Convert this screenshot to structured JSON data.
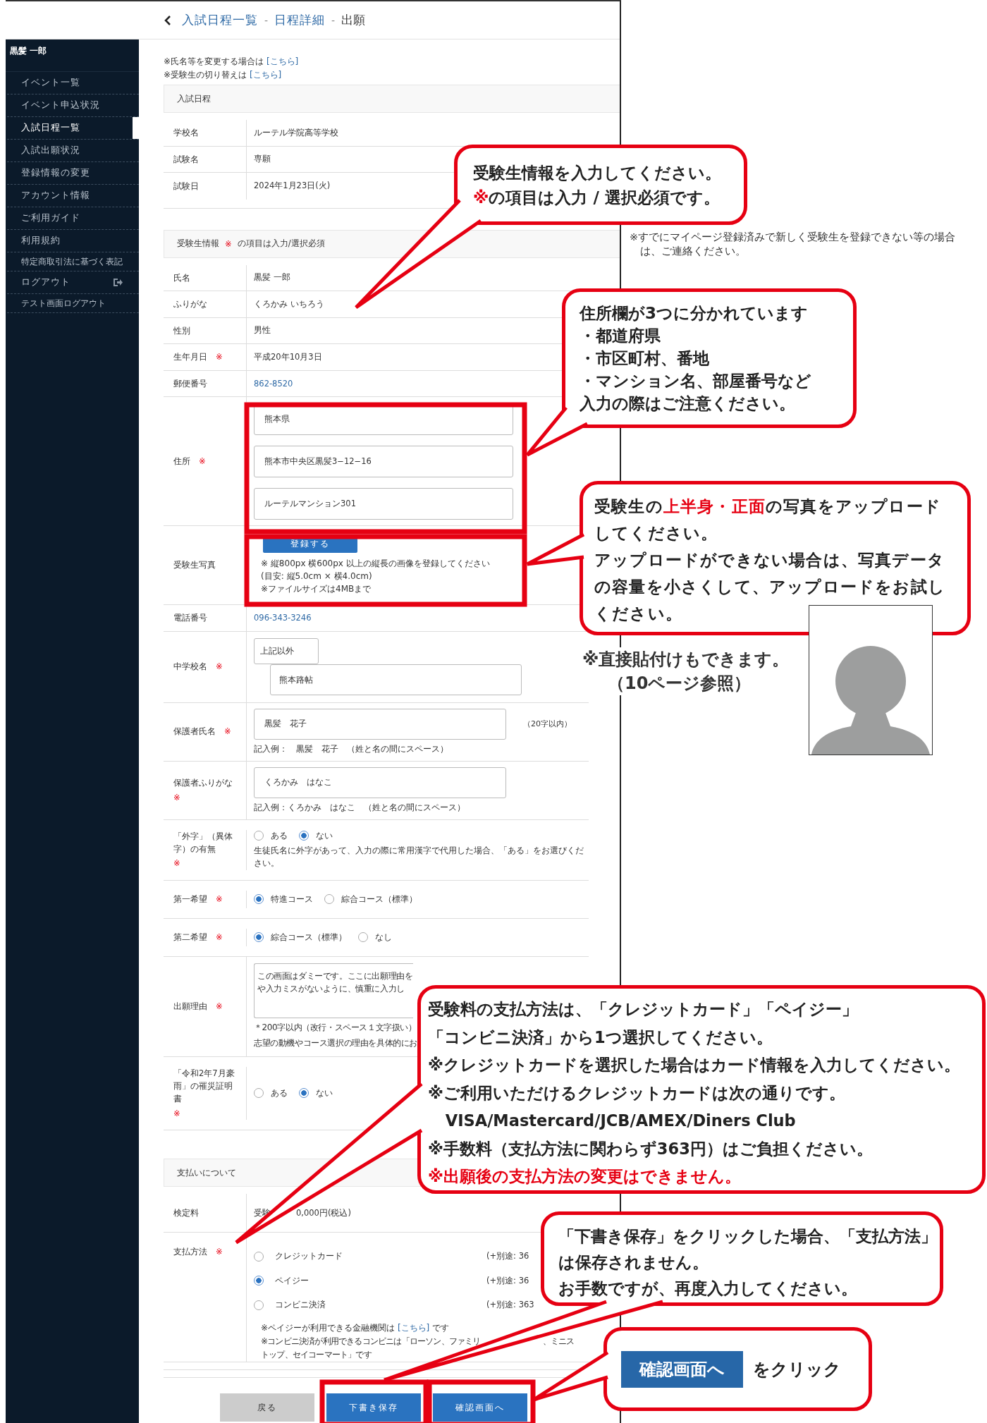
{
  "breadcrumb": [
    {
      "kind": "link",
      "label": "入試日程一覧"
    },
    {
      "kind": "separator",
      "label": "-"
    },
    {
      "kind": "link",
      "label": "日程詳細"
    },
    {
      "kind": "separator",
      "label": "-"
    },
    {
      "kind": "current",
      "label": "出願"
    }
  ],
  "sidebar": {
    "user": "黒髪 一郎",
    "items": [
      {
        "kind": "normal",
        "label": "イベント一覧",
        "selected": false
      },
      {
        "kind": "normal",
        "label": "イベント申込状況",
        "selected": false
      },
      {
        "kind": "normal",
        "label": "入試日程一覧",
        "selected": true
      },
      {
        "kind": "normal",
        "label": "入試出願状況",
        "selected": false
      },
      {
        "kind": "normal",
        "label": "登録情報の変更",
        "selected": false
      },
      {
        "kind": "normal",
        "label": "アカウント情報",
        "selected": false
      },
      {
        "kind": "normal",
        "label": "ご利用ガイド",
        "selected": false
      },
      {
        "kind": "normal",
        "label": "利用規約",
        "selected": false
      },
      {
        "kind": "small",
        "label": "特定商取引法に基づく表記",
        "selected": false
      },
      {
        "kind": "logout",
        "label": "ログアウト",
        "selected": false
      },
      {
        "kind": "small",
        "label": "テスト画面ログアウト",
        "selected": false
      }
    ]
  },
  "notes": [
    {
      "text": "※氏名等を変更する場合は",
      "link": "[こちら]"
    },
    {
      "text": "※受験生の切り替えは",
      "link": "[こちら]"
    }
  ],
  "schedule": {
    "title": "入試日程",
    "rows": [
      {
        "label": "学校名",
        "value": "ルーテル学院高等学校"
      },
      {
        "label": "試験名",
        "value": "専願"
      },
      {
        "label": "試験日",
        "value": "2024年1月23日(火)"
      }
    ]
  },
  "applicant": {
    "title": "受験生情報",
    "title_mark": "※",
    "title_note": "の項目は入力/選択必須",
    "rows": [
      {
        "kind": "text",
        "label": "氏名",
        "value": "黒髪 一郎"
      },
      {
        "kind": "text",
        "label": "ふりがな",
        "value": "くろかみ いちろう"
      },
      {
        "kind": "text",
        "label": "性別",
        "value": "男性"
      },
      {
        "kind": "text",
        "label": "生年月日",
        "mark": "※",
        "value": "平成20年10月3日"
      },
      {
        "kind": "link",
        "label": "郵便番号",
        "value": "862-8520"
      },
      {
        "kind": "address",
        "label": "住所",
        "mark": "※",
        "inputs": [
          "熊本県",
          "熊本市中央区黒髪3−12−16",
          "ルーテルマンション301"
        ]
      },
      {
        "kind": "upload",
        "label": "受験生写真",
        "button": "登録する",
        "notes": [
          "※ 縦800px 横600px 以上の縦長の画像を登録してください",
          "(目安: 縦5.0cm × 横4.0cm)",
          "※ファイルサイズは4MBまで"
        ]
      },
      {
        "kind": "link",
        "label": "電話番号",
        "value": "096-343-3246"
      },
      {
        "kind": "school",
        "label": "中学校名",
        "mark": "※",
        "select": "上記以外",
        "input": "熊本路帖"
      },
      {
        "kind": "input",
        "label": "保護者氏名",
        "mark": "※",
        "value": "黒髪　花子",
        "suffix": "（20字以内）",
        "hint": "記入例：　黒髪　花子　（姓と名の間にスペース）"
      },
      {
        "kind": "input",
        "label": "保護者ふりがな",
        "mark": "※",
        "value": "くろかみ　はなこ",
        "hint": "記入例：くろかみ　はなこ　（姓と名の間にスペース）"
      },
      {
        "kind": "radio",
        "label": "「外字」（異体字）の有無",
        "mark": "※",
        "options": [
          {
            "label": "ある",
            "selected": false
          },
          {
            "label": "ない",
            "selected": true
          }
        ],
        "note": "生徒氏名に外字があって、入力の際に常用漢字で代用した場合、「ある」をお選びください。"
      },
      {
        "kind": "radio",
        "label": "第一希望",
        "mark": "※",
        "options": [
          {
            "label": "特進コース",
            "selected": true
          },
          {
            "label": "綜合コース（標準）",
            "selected": false
          }
        ]
      },
      {
        "kind": "radio",
        "label": "第二希望",
        "mark": "※",
        "options": [
          {
            "label": "綜合コース（標準）",
            "selected": true
          },
          {
            "label": "なし",
            "selected": false
          }
        ]
      },
      {
        "kind": "textarea",
        "label": "出願理由",
        "mark": "※",
        "lines": [
          "この画面はダミーです。ここに出願理由を",
          "や入力ミスがないように、慎重に入力し"
        ],
        "notes": [
          "＊200字以内（改行・スペース１文字扱い）",
          "志望の動機やコース選択の理由を具体的にお"
        ]
      },
      {
        "kind": "radio",
        "label": "「令和2年7月豪雨」の罹災証明書",
        "mark": "※",
        "options": [
          {
            "label": "ある",
            "selected": false
          },
          {
            "label": "ない",
            "selected": true
          }
        ]
      }
    ]
  },
  "payment": {
    "title": "支払いについて",
    "fee_label": "検定料",
    "fee_start": "受験",
    "fee_end": "0,000円(税込)",
    "method_label": "支払方法",
    "method_mark": "※",
    "methods": [
      {
        "label": "クレジットカード",
        "fee": "(+別途: 36",
        "selected": false
      },
      {
        "label": "ペイジー",
        "fee": "(+別途: 36",
        "selected": true
      },
      {
        "label": "コンビニ決済",
        "fee": "(+別途: 363",
        "selected": false
      }
    ],
    "notes": [
      {
        "text": "※ペイジーが利用できる金融機関は",
        "link": "[こちら]",
        "after": "です"
      },
      {
        "text": "※コンビニ決済が利用できるコンビニは「ローソン、ファミリ",
        "text_end": [
          "、ミニス",
          "トップ、セイコーマート」です"
        ]
      }
    ]
  },
  "buttons": [
    {
      "kind": "back",
      "label": "戻る"
    },
    {
      "kind": "primary",
      "label": "下書き保存"
    },
    {
      "kind": "primary",
      "label": "確認画面へ"
    }
  ],
  "annotations": {
    "side_note": "※すでにマイページ登録済みで新しく受験生を登録できない等の場合は、ご連絡ください。",
    "paste_note": [
      "※直接貼付けもできます。",
      "（10ページ参照）"
    ],
    "callouts": [
      {
        "kind": "text",
        "paragraphs": [
          {
            "lines": [
              {
                "parts": [
                  {
                    "text": "受験生情報を入力してください。",
                    "emphasis": false
                  }
                ]
              }
            ]
          },
          {
            "lines": [
              {
                "parts": [
                  {
                    "text": "※",
                    "emphasis": true
                  },
                  {
                    "text": "の項目は入力 / 選択必須です。",
                    "emphasis": false
                  }
                ]
              }
            ]
          }
        ]
      },
      {
        "kind": "text",
        "paragraphs": [
          {
            "lines": [
              {
                "parts": [
                  {
                    "text": "住所欄が3つに分かれています",
                    "emphasis": false
                  }
                ]
              }
            ]
          },
          {
            "lines": [
              {
                "parts": [
                  {
                    "text": "・都道府県",
                    "emphasis": false
                  }
                ]
              }
            ]
          },
          {
            "lines": [
              {
                "parts": [
                  {
                    "text": "・市区町村、番地",
                    "emphasis": false
                  }
                ]
              }
            ]
          },
          {
            "lines": [
              {
                "parts": [
                  {
                    "text": "・マンション名、部屋番号など",
                    "emphasis": false
                  }
                ]
              }
            ]
          },
          {
            "lines": [
              {
                "parts": [
                  {
                    "text": "入力の際はご注意ください。",
                    "emphasis": false
                  }
                ]
              }
            ]
          }
        ]
      },
      {
        "kind": "text",
        "paragraphs": [
          {
            "lines": [
              {
                "parts": [
                  {
                    "text": "受験生の",
                    "emphasis": false
                  },
                  {
                    "text": "上半身・正面",
                    "emphasis": true
                  },
                  {
                    "text": "の写真をアップロード",
                    "emphasis": false
                  }
                ]
              },
              {
                "parts": [
                  {
                    "text": "してください。",
                    "emphasis": false
                  }
                ]
              }
            ]
          },
          {
            "lines": [
              {
                "parts": [
                  {
                    "text": "アップロードができない場合は、写真データ",
                    "emphasis": false
                  }
                ]
              },
              {
                "parts": [
                  {
                    "text": "の容量を小さくして、アップロードをお試し",
                    "emphasis": false
                  }
                ]
              },
              {
                "parts": [
                  {
                    "text": "ください。",
                    "emphasis": false
                  }
                ]
              }
            ]
          }
        ]
      },
      {
        "kind": "text",
        "paragraphs": [
          {
            "lines": [
              {
                "parts": [
                  {
                    "text": "受験料の支払方法は、「クレジットカード」「ペイジー」",
                    "emphasis": false
                  }
                ]
              },
              {
                "parts": [
                  {
                    "text": "「コンビニ決済」から1つ選択してください。",
                    "emphasis": false
                  }
                ]
              }
            ]
          },
          {
            "lines": [
              {
                "parts": [
                  {
                    "text": "※クレジットカードを選択した場合はカード情報を入力してください。",
                    "emphasis": false
                  }
                ]
              }
            ]
          },
          {
            "lines": [
              {
                "parts": [
                  {
                    "text": "※ご利用いただけるクレジットカードは次の通りです。",
                    "emphasis": false
                  }
                ]
              },
              {
                "indent": true,
                "parts": [
                  {
                    "text": "VISA/Mastercard/JCB/AMEX/Diners Club",
                    "emphasis": false
                  }
                ]
              }
            ]
          },
          {
            "lines": [
              {
                "parts": [
                  {
                    "text": "※手数料（支払方法に関わらず363円）はご負担ください。",
                    "emphasis": false
                  }
                ]
              }
            ]
          },
          {
            "lines": [
              {
                "parts": [
                  {
                    "text": "※出願後の支払方法の変更はできません。",
                    "emphasis": true
                  }
                ]
              }
            ]
          }
        ]
      },
      {
        "kind": "text",
        "paragraphs": [
          {
            "lines": [
              {
                "parts": [
                  {
                    "text": "「下書き保存」をクリックした場合、「支払方法」",
                    "emphasis": false
                  }
                ]
              },
              {
                "parts": [
                  {
                    "text": "は保存されません。",
                    "emphasis": false
                  }
                ]
              }
            ]
          },
          {
            "lines": [
              {
                "parts": [
                  {
                    "text": "お手数ですが、再度入力してください。",
                    "emphasis": false
                  }
                ]
              }
            ]
          }
        ]
      },
      {
        "kind": "button_hint",
        "button": "確認画面へ",
        "text": "をクリック"
      }
    ]
  }
}
